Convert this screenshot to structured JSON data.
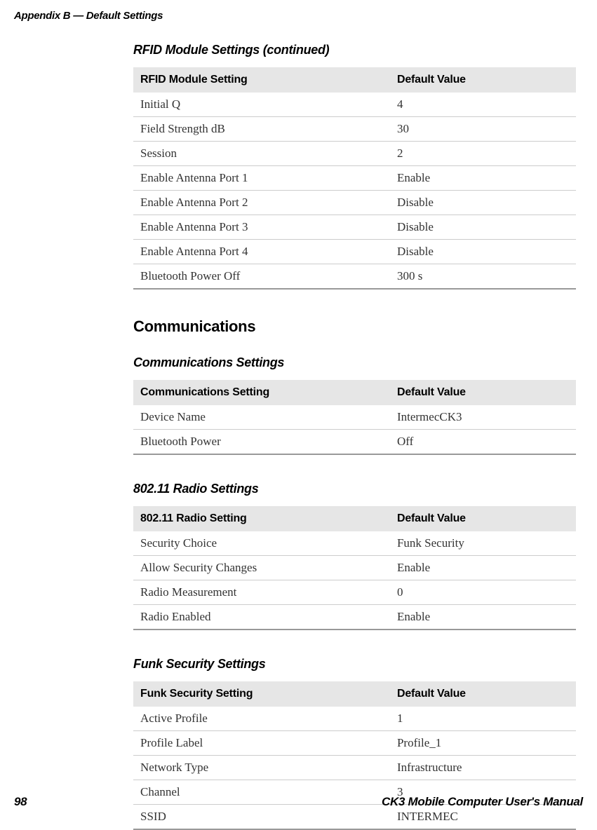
{
  "header": {
    "appendix_title": "Appendix B — Default Settings"
  },
  "tables": {
    "rfid": {
      "title": "RFID Module Settings (continued)",
      "col1": "RFID Module Setting",
      "col2": "Default Value",
      "rows": [
        {
          "setting": "Initial Q",
          "value": "4"
        },
        {
          "setting": "Field Strength dB",
          "value": "30"
        },
        {
          "setting": "Session",
          "value": "2"
        },
        {
          "setting": "Enable Antenna Port 1",
          "value": "Enable"
        },
        {
          "setting": "Enable Antenna Port 2",
          "value": "Disable"
        },
        {
          "setting": "Enable Antenna Port 3",
          "value": "Disable"
        },
        {
          "setting": "Enable Antenna Port 4",
          "value": "Disable"
        },
        {
          "setting": "Bluetooth Power Off",
          "value": "300 s"
        }
      ]
    },
    "communications": {
      "heading": "Communications",
      "title": "Communications Settings",
      "col1": "Communications Setting",
      "col2": "Default Value",
      "rows": [
        {
          "setting": "Device Name",
          "value": "IntermecCK3"
        },
        {
          "setting": "Bluetooth Power",
          "value": "Off"
        }
      ]
    },
    "radio": {
      "title": "802.11 Radio Settings",
      "col1": "802.11 Radio Setting",
      "col2": "Default Value",
      "rows": [
        {
          "setting": "Security Choice",
          "value": "Funk Security"
        },
        {
          "setting": "Allow Security Changes",
          "value": "Enable"
        },
        {
          "setting": "Radio Measurement",
          "value": "0"
        },
        {
          "setting": "Radio Enabled",
          "value": "Enable"
        }
      ]
    },
    "funk": {
      "title": "Funk Security Settings",
      "col1": "Funk Security Setting",
      "col2": "Default Value",
      "rows": [
        {
          "setting": "Active Profile",
          "value": "1"
        },
        {
          "setting": "Profile Label",
          "value": "Profile_1"
        },
        {
          "setting": "Network Type",
          "value": "Infrastructure"
        },
        {
          "setting": "Channel",
          "value": "3"
        },
        {
          "setting": "SSID",
          "value": "INTERMEC"
        }
      ]
    }
  },
  "footer": {
    "page_number": "98",
    "manual_title": "CK3 Mobile Computer User's Manual"
  }
}
